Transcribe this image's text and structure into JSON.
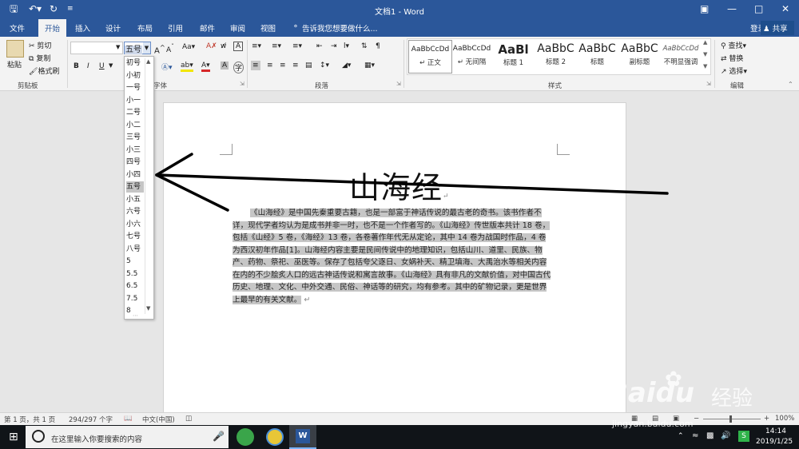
{
  "titlebar": {
    "save_icon": "save-icon",
    "undo_icon": "undo-icon",
    "redo_icon": "redo-icon",
    "title": "文档1 - Word"
  },
  "tabs": [
    "文件",
    "开始",
    "插入",
    "设计",
    "布局",
    "引用",
    "邮件",
    "审阅",
    "视图"
  ],
  "tell_me": "告诉我您想要做什么...",
  "account": {
    "login": "登录",
    "share": "共享"
  },
  "clipboard": {
    "paste": "粘贴",
    "cut": "剪切",
    "copy": "复制",
    "format_painter": "格式刷",
    "group": "剪贴板"
  },
  "font": {
    "size_value": "五号",
    "group": "字体",
    "bold": "B",
    "italic": "I",
    "underline": "U",
    "change_case": "Aa",
    "grow": "A",
    "shrink": "A",
    "clear": "A",
    "text_effects": "A",
    "char_shade": "A",
    "char_border": "A",
    "highlight": "ab"
  },
  "paragraph": {
    "group": "段落"
  },
  "styles": {
    "group": "样式",
    "items": [
      {
        "preview": "AaBbCcDd",
        "name": "↵ 正文"
      },
      {
        "preview": "AaBbCcDd",
        "name": "↵ 无间隔"
      },
      {
        "preview": "AaBl",
        "name": "标题 1"
      },
      {
        "preview": "AaBbC",
        "name": "标题 2"
      },
      {
        "preview": "AaBbC",
        "name": "标题"
      },
      {
        "preview": "AaBbC",
        "name": "副标题"
      },
      {
        "preview": "AaBbCcDd",
        "name": "不明显强调"
      }
    ]
  },
  "editing": {
    "find": "查找",
    "replace": "替换",
    "select": "选择",
    "group": "编辑"
  },
  "fontsize_dropdown": [
    "初号",
    "小初",
    "一号",
    "小一",
    "二号",
    "小二",
    "三号",
    "小三",
    "四号",
    "小四",
    "五号",
    "小五",
    "六号",
    "小六",
    "七号",
    "八号",
    "5",
    "5.5",
    "6.5",
    "7.5",
    "8"
  ],
  "fontsize_selected": "五号",
  "document": {
    "title": "山海经",
    "title_mark": "↵",
    "body": "《山海经》是中国先秦重要古籍，也是一部富于神话传说的最古老的奇书。该书作者不详，现代学者均认为是成书并非一时，也不是一个作者写的。《山海经》传世版本共计 18 卷，包括《山经》5 卷，《海经》13 卷，各卷著作年代无从定论，其中 14 卷为战国时作品，4 卷为西汉初年作品[1]。山海经内容主要是民间传说中的地理知识，包括山川、道里、民族、物产、药物、祭祀、巫医等。保存了包括夸父逐日、女娲补天、精卫填海、大禹治水等相关内容在内的不少脍炙人口的远古神话传说和寓言故事。《山海经》具有非凡的文献价值，对中国古代历史、地理、文化、中外交通、民俗、神话等的研究，均有参考。其中的矿物记录，更是世界上最早的有关文献。",
    "end_mark": "↵"
  },
  "statusbar": {
    "page": "第 1 页，共 1 页",
    "words": "294/297 个字",
    "lang": "中文(中国)",
    "zoom": "100%",
    "minus": "−",
    "plus": "+"
  },
  "taskbar": {
    "search_placeholder": "在这里输入你要搜索的内容",
    "time": "14:14",
    "date": "2019/1/25",
    "apps": [
      "app-green-icon",
      "app-browser-icon",
      "word-icon"
    ]
  },
  "watermark": {
    "brand": "Baidu",
    "suffix": "经验",
    "url": "jingyan.baidu.com"
  },
  "colors": {
    "word_blue": "#2b579a",
    "selection": "#c6c6c6",
    "taskbar": "#101418"
  }
}
